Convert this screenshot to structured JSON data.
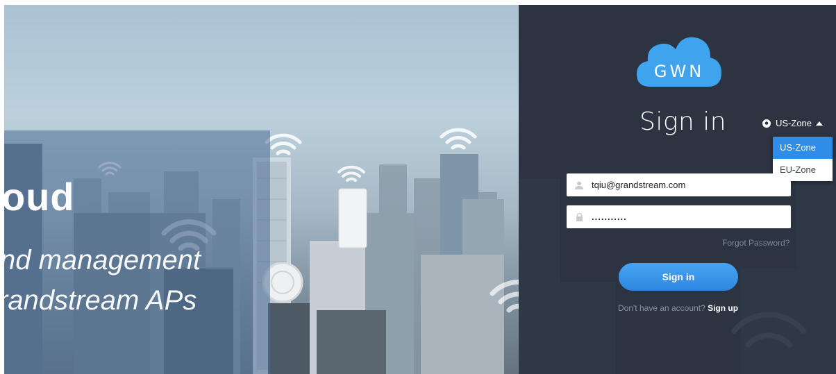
{
  "hero": {
    "line1": "oud",
    "line2": "nd management",
    "line3": "randstream APs"
  },
  "logo": {
    "text": "GWN",
    "icon": "cloud-logo-icon",
    "color": "#3fa3ee"
  },
  "login": {
    "title": "Sign in",
    "zone": {
      "selected": "US-Zone",
      "icon": "location-pin-icon",
      "options": [
        "US-Zone",
        "EU-Zone"
      ]
    },
    "email": {
      "value": "tqiu@grandstream.com",
      "icon": "user-icon"
    },
    "password": {
      "value": "...........",
      "icon": "lock-icon"
    },
    "forgot_label": "Forgot Password?",
    "submit_label": "Sign in",
    "signup_prompt": "Don't have an account?",
    "signup_label": "Sign up"
  },
  "colors": {
    "panel_bg": "#2c3442",
    "accent": "#2d8de8",
    "hero_overlay": "#4e7096"
  }
}
